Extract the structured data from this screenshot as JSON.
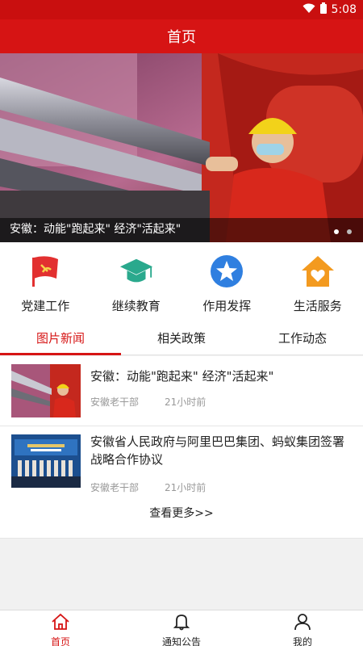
{
  "status_bar": {
    "time": "5:08",
    "icons": [
      "wifi-icon",
      "battery-icon"
    ]
  },
  "header": {
    "title": "首页"
  },
  "banner": {
    "caption": "安徽：动能\"跑起来\" 经济\"活起来\"",
    "slide_count": 2,
    "active_slide": 1
  },
  "quick_nav": {
    "items": [
      {
        "label": "党建工作",
        "icon": "party-flag-icon",
        "color": "#e23030"
      },
      {
        "label": "继续教育",
        "icon": "graduation-cap-icon",
        "color": "#2aa98d"
      },
      {
        "label": "作用发挥",
        "icon": "star-badge-icon",
        "color": "#2f7fe0"
      },
      {
        "label": "生活服务",
        "icon": "house-heart-icon",
        "color": "#f39a1f"
      }
    ]
  },
  "tabs": {
    "items": [
      {
        "label": "图片新闻",
        "active": true
      },
      {
        "label": "相关政策",
        "active": false
      },
      {
        "label": "工作动态",
        "active": false
      }
    ]
  },
  "news": {
    "items": [
      {
        "title": "安徽：动能\"跑起来\" 经济\"活起来\"",
        "source": "安徽老干部",
        "time": "21小时前"
      },
      {
        "title": "安徽省人民政府与阿里巴巴集团、蚂蚁集团签署战略合作协议",
        "source": "安徽老干部",
        "time": "21小时前"
      }
    ],
    "more_label": "查看更多>>"
  },
  "bottom_nav": {
    "items": [
      {
        "label": "首页",
        "icon": "home-icon",
        "active": true
      },
      {
        "label": "通知公告",
        "icon": "bell-icon",
        "active": false
      },
      {
        "label": "我的",
        "icon": "user-icon",
        "active": false
      }
    ]
  },
  "colors": {
    "brand": "#d61414",
    "status_bar": "#c90f0f"
  }
}
